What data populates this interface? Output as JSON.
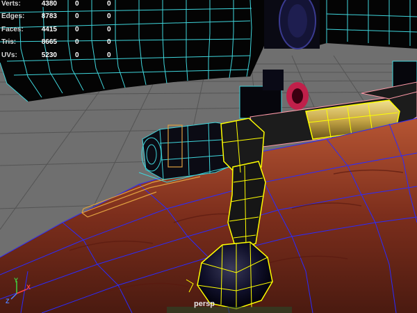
{
  "viewport": {
    "camera": "persp",
    "background_color": "#6f6f6f",
    "grid_color": "#505050"
  },
  "poly_count": [
    {
      "label": "Verts:",
      "values": [
        "4380",
        "0",
        "0"
      ]
    },
    {
      "label": "Edges:",
      "values": [
        "8783",
        "0",
        "0"
      ]
    },
    {
      "label": "Faces:",
      "values": [
        "4415",
        "0",
        "0"
      ]
    },
    {
      "label": "Tris:",
      "values": [
        "8665",
        "0",
        "0"
      ]
    },
    {
      "label": "UVs:",
      "values": [
        "5230",
        "0",
        "0"
      ]
    }
  ],
  "axis": {
    "x_label": "X",
    "y_label": "Y",
    "z_label": "Z",
    "x_color": "#ff4040",
    "y_color": "#40d040",
    "z_color": "#5080ff"
  },
  "colors": {
    "wireframe_cyan": "#3fd6dc",
    "wireframe_blue": "#2b2bff",
    "selected_yellow": "#ffff00",
    "wood": "#8a3a22",
    "rail_orange": "#e0a040",
    "highlight_pink": "#ff9aa8"
  }
}
